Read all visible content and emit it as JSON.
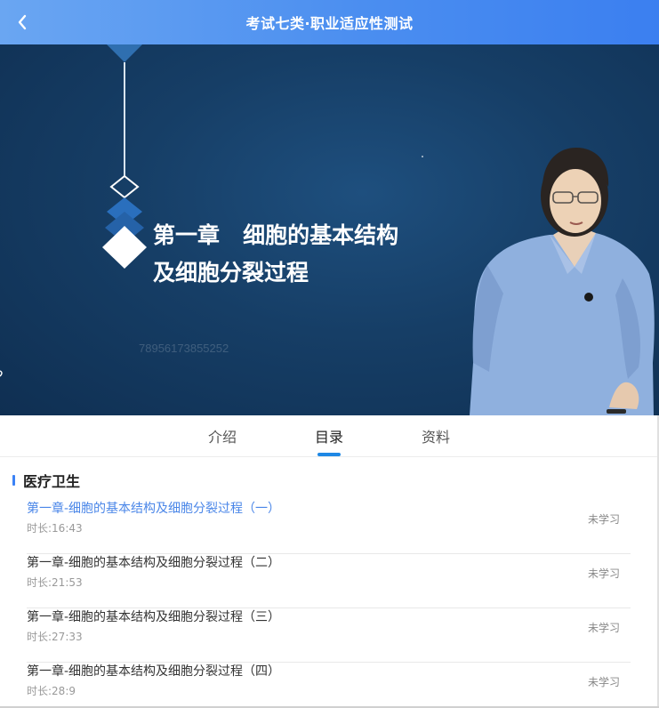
{
  "header": {
    "title": "考试七类·职业适应性测试",
    "back_icon": "chevron-left-icon"
  },
  "video": {
    "slide_title": "第一章   细胞的基本结构\n及细胞分裂过程",
    "watermark": "78956173855252",
    "background_color": "#163e66"
  },
  "tabs": [
    {
      "label": "介绍",
      "active": false
    },
    {
      "label": "目录",
      "active": true
    },
    {
      "label": "资料",
      "active": false
    }
  ],
  "section": {
    "title": "医疗卫生"
  },
  "lessons": [
    {
      "title": "第一章-细胞的基本结构及细胞分裂过程（一）",
      "duration": "时长:16:43",
      "status": "未学习",
      "current": true
    },
    {
      "title": "第一章-细胞的基本结构及细胞分裂过程（二）",
      "duration": "时长:21:53",
      "status": "未学习",
      "current": false
    },
    {
      "title": "第一章-细胞的基本结构及细胞分裂过程（三）",
      "duration": "时长:27:33",
      "status": "未学习",
      "current": false
    },
    {
      "title": "第一章-细胞的基本结构及细胞分裂过程（四）",
      "duration": "时长:28:9",
      "status": "未学习",
      "current": false
    }
  ],
  "colors": {
    "header_accent": "#4b8ef0",
    "active_tab_underline": "#1e88e5",
    "current_lesson": "#4a86e8"
  }
}
